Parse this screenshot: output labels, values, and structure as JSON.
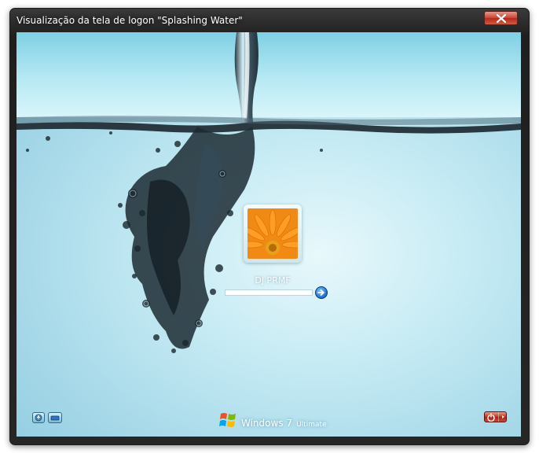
{
  "window": {
    "title": "Visualização da tela de logon \"Splashing Water\""
  },
  "logon": {
    "username": "DJ PRMF",
    "password_value": "",
    "branding_name": "Windows 7",
    "branding_edition": "Ultimate"
  },
  "icons": {
    "close": "close-icon",
    "go": "arrow-right-icon",
    "ease_of_access": "ease-of-access-icon",
    "input_language": "keyboard-icon",
    "shutdown": "power-icon",
    "shutdown_options": "chevron-right-icon",
    "brand_logo": "windows-flag-icon"
  },
  "colors": {
    "close_button": "#c9432f",
    "shutdown_button": "#c0341f",
    "go_button": "#1e6fd1",
    "water_light": "#e8f8fb",
    "water_dark": "#8fcbe0"
  }
}
